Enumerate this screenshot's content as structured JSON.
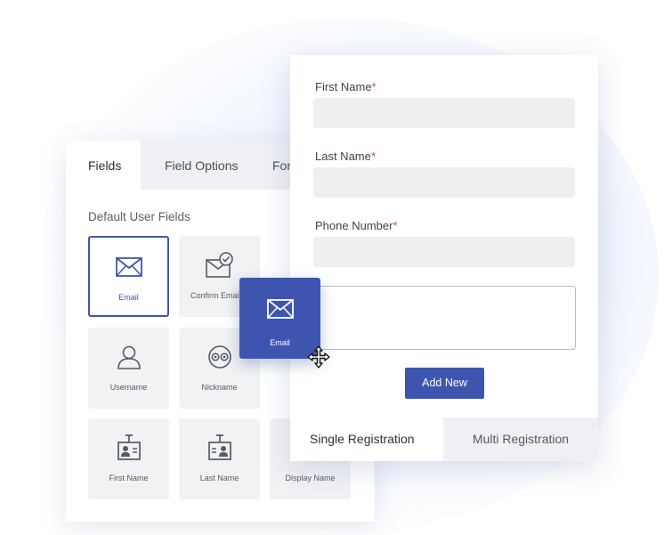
{
  "builder": {
    "tabs": [
      {
        "label": "Fields",
        "active": true
      },
      {
        "label": "Field Options",
        "active": false
      },
      {
        "label": "For",
        "active": false
      }
    ],
    "section_title": "Default User Fields",
    "tiles": [
      {
        "label": "Email",
        "icon": "envelope-icon",
        "selected": true
      },
      {
        "label": "Confirm Email",
        "icon": "envelope-check-icon",
        "selected": false
      },
      {
        "label": "Username",
        "icon": "user-icon",
        "selected": false
      },
      {
        "label": "Nickname",
        "icon": "mask-icon",
        "selected": false
      },
      {
        "label": "First Name",
        "icon": "id-badge-icon",
        "selected": false
      },
      {
        "label": "Last Name",
        "icon": "id-badge-icon",
        "selected": false
      },
      {
        "label": "Display Name",
        "icon": "display-name-icon",
        "selected": false
      }
    ]
  },
  "form": {
    "fields": [
      {
        "label": "First Name",
        "required_mark": "*"
      },
      {
        "label": "Last Name",
        "required_mark": "*"
      },
      {
        "label": "Phone Number",
        "required_mark": "*"
      }
    ],
    "add_button": "Add New",
    "registration_tabs": [
      {
        "label": "Single Registration",
        "active": true
      },
      {
        "label": "Multi Registration",
        "active": false
      }
    ]
  },
  "drag_tile": {
    "label": "Email",
    "icon": "envelope-icon"
  },
  "colors": {
    "accent": "#3e55b0",
    "required": "#e0453d",
    "tile_bg": "#f1f2f4"
  }
}
